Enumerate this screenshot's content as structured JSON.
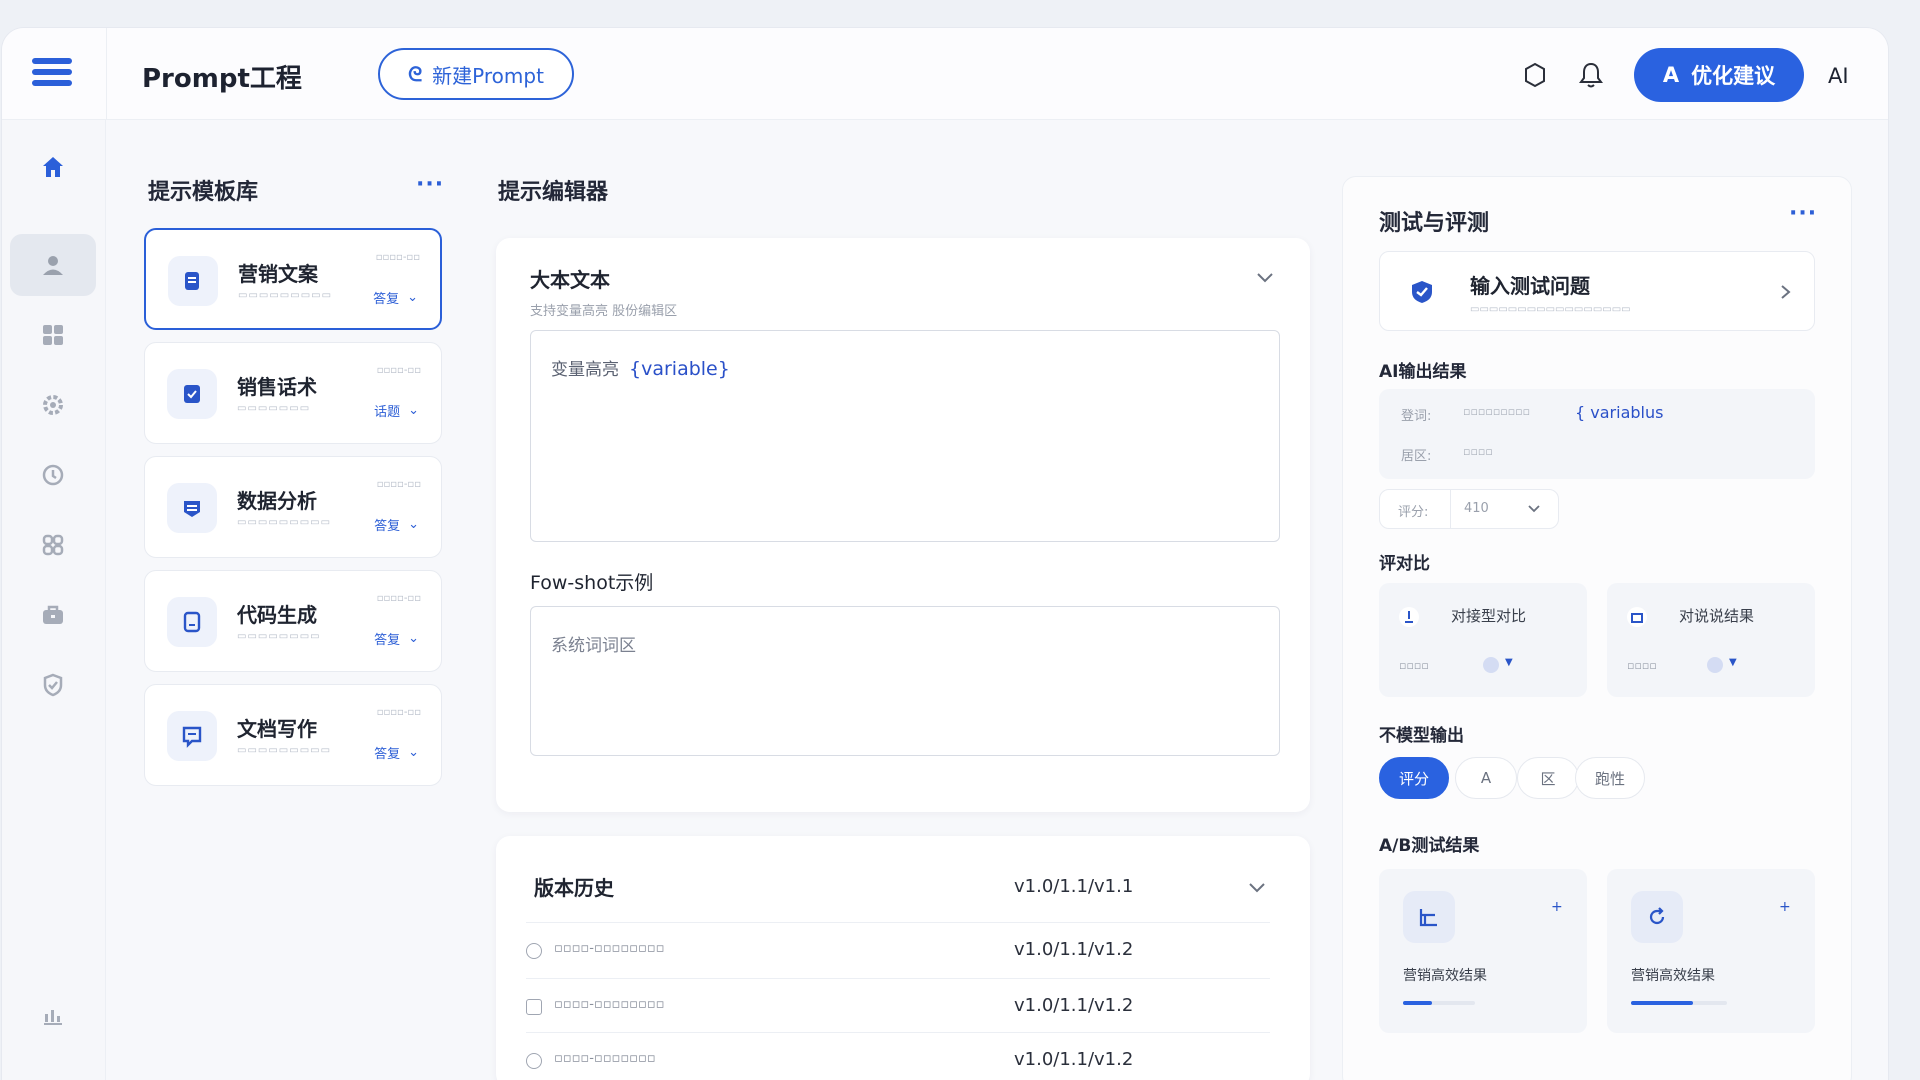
{
  "topbar": {
    "title": "Prompt工程",
    "new_button": "新建Prompt",
    "optimize_button": "优化建议",
    "ai_label": "AI"
  },
  "library": {
    "title": "提示模板库",
    "more": "···",
    "templates": [
      {
        "name": "营销文案",
        "action": "答复"
      },
      {
        "name": "销售话术",
        "action": "话题"
      },
      {
        "name": "数据分析",
        "action": "答复"
      },
      {
        "name": "代码生成",
        "action": "答复"
      },
      {
        "name": "文档写作",
        "action": "答复"
      }
    ]
  },
  "editor": {
    "title": "提示编辑器",
    "main_title": "大本文本",
    "main_sub": "支持变量高亮 股份编辑区",
    "main_placeholder": "变量高亮",
    "variable": "{variable}",
    "fewshot_title": "Fow-shot示例",
    "fewshot_placeholder": "系统词词区",
    "history_title": "版本历史",
    "history_version": "v1.0/1.1/v1.1",
    "history": [
      {
        "version": "v1.0/1.1/v1.2"
      },
      {
        "version": "v1.0/1.1/v1.2"
      },
      {
        "version": "v1.0/1.1/v1.2"
      }
    ]
  },
  "test": {
    "title": "测试与评测",
    "more": "···",
    "input_label": "输入测试问题",
    "output_title": "AI输出结果",
    "output_k1": "登词:",
    "output_var": "{ variablus",
    "output_k2": "居区:",
    "score_label": "评分:",
    "score_value": "410",
    "compare_title": "评对比",
    "compare": [
      {
        "label": "对接型对比"
      },
      {
        "label": "对说说结果"
      }
    ],
    "model_title": "不模型输出",
    "model_tabs": [
      "评分",
      "A",
      "区",
      "跑性"
    ],
    "ab_title": "A/B测试结果",
    "ab": [
      {
        "label": "营销高效结果",
        "progress": 0.4
      },
      {
        "label": "营销高效结果",
        "progress": 0.65
      }
    ]
  },
  "colors": {
    "accent": "#2a62e0",
    "border": "#e8ebf1"
  }
}
